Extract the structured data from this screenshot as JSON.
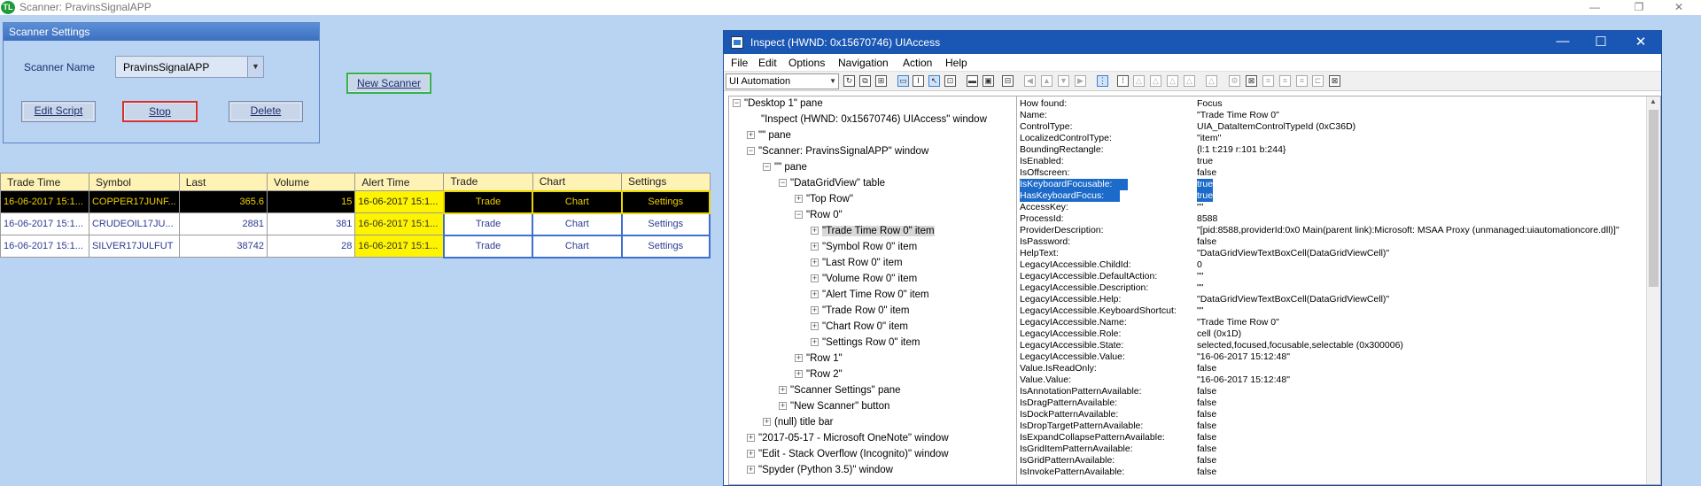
{
  "window": {
    "app_icon": "TL",
    "title": "Scanner: PravinsSignalAPP",
    "min_glyph": "—",
    "max_glyph": "❐",
    "close_glyph": "✕"
  },
  "scanner_settings": {
    "header": "Scanner Settings",
    "name_label": "Scanner Name",
    "name_value": "PravinsSignalAPP",
    "edit_script": "Edit Script",
    "stop": "Stop",
    "delete": "Delete"
  },
  "new_scanner": "New Scanner",
  "grid": {
    "columns": [
      "Trade Time",
      "Symbol",
      "Last",
      "Volume",
      "Alert Time",
      "Trade",
      "Chart",
      "Settings"
    ],
    "rows": [
      {
        "trade_time": "16-06-2017 15:1...",
        "symbol": "COPPER17JUNF...",
        "last": "365.6",
        "volume": "15",
        "alert_time": "16-06-2017 15:1...",
        "trade": "Trade",
        "chart": "Chart",
        "settings": "Settings"
      },
      {
        "trade_time": "16-06-2017 15:1...",
        "symbol": "CRUDEOIL17JU...",
        "last": "2881",
        "volume": "381",
        "alert_time": "16-06-2017 15:1...",
        "trade": "Trade",
        "chart": "Chart",
        "settings": "Settings"
      },
      {
        "trade_time": "16-06-2017 15:1...",
        "symbol": "SILVER17JULFUT",
        "last": "38742",
        "volume": "28",
        "alert_time": "16-06-2017 15:1...",
        "trade": "Trade",
        "chart": "Chart",
        "settings": "Settings"
      }
    ]
  },
  "inspect": {
    "title": "Inspect  (HWND: 0x15670746) UIAccess",
    "menu": [
      "File",
      "Edit",
      "Options",
      "Navigation",
      "Action",
      "Help"
    ],
    "mode": "UI Automation",
    "tree": [
      {
        "label": "\"Desktop 1\" pane",
        "exp": "−"
      },
      {
        "label": "\"Inspect  (HWND: 0x15670746) UIAccess\" window",
        "exp": ""
      },
      {
        "label": "\"\" pane",
        "exp": "+"
      },
      {
        "label": "\"Scanner: PravinsSignalAPP\" window",
        "exp": "−"
      },
      {
        "label": "\"\" pane",
        "exp": "−"
      },
      {
        "label": "\"DataGridView\" table",
        "exp": "−"
      },
      {
        "label": "\"Top Row\"",
        "exp": "+"
      },
      {
        "label": "\"Row 0\"",
        "exp": "−"
      },
      {
        "label": "\"Trade Time Row 0\" item",
        "exp": "+"
      },
      {
        "label": "\"Symbol Row 0\" item",
        "exp": "+"
      },
      {
        "label": "\"Last Row 0\" item",
        "exp": "+"
      },
      {
        "label": "\"Volume Row 0\" item",
        "exp": "+"
      },
      {
        "label": "\"Alert Time Row 0\" item",
        "exp": "+"
      },
      {
        "label": "\"Trade Row 0\" item",
        "exp": "+"
      },
      {
        "label": "\"Chart Row 0\" item",
        "exp": "+"
      },
      {
        "label": "\"Settings Row 0\" item",
        "exp": "+"
      },
      {
        "label": "\"Row 1\"",
        "exp": "+"
      },
      {
        "label": "\"Row 2\"",
        "exp": "+"
      },
      {
        "label": "\"Scanner Settings\" pane",
        "exp": "+"
      },
      {
        "label": "\"New Scanner\" button",
        "exp": "+"
      },
      {
        "label": "(null) title bar",
        "exp": "+"
      },
      {
        "label": "\"2017-05-17 - Microsoft OneNote\" window",
        "exp": "+"
      },
      {
        "label": "\"Edit - Stack Overflow (Incognito)\" window",
        "exp": "+"
      },
      {
        "label": "\"Spyder (Python 3.5)\" window",
        "exp": "+"
      }
    ],
    "properties": [
      {
        "k": "How found:",
        "v": "Focus"
      },
      {
        "k": "Name:",
        "v": "\"Trade Time Row 0\""
      },
      {
        "k": "ControlType:",
        "v": "UIA_DataItemControlTypeId (0xC36D)"
      },
      {
        "k": "LocalizedControlType:",
        "v": "\"item\""
      },
      {
        "k": "BoundingRectangle:",
        "v": "{l:1 t:219 r:101 b:244}"
      },
      {
        "k": "IsEnabled:",
        "v": "true"
      },
      {
        "k": "IsOffscreen:",
        "v": "false"
      },
      {
        "k": "IsKeyboardFocusable:",
        "v": "true"
      },
      {
        "k": "HasKeyboardFocus:",
        "v": "true"
      },
      {
        "k": "AccessKey:",
        "v": "\"\""
      },
      {
        "k": "ProcessId:",
        "v": "8588"
      },
      {
        "k": "ProviderDescription:",
        "v": "\"[pid:8588,providerId:0x0 Main(parent link):Microsoft: MSAA Proxy (unmanaged:uiautomationcore.dll)]\""
      },
      {
        "k": "IsPassword:",
        "v": "false"
      },
      {
        "k": "HelpText:",
        "v": "\"DataGridViewTextBoxCell(DataGridViewCell)\""
      },
      {
        "k": "LegacyIAccessible.ChildId:",
        "v": "0"
      },
      {
        "k": "LegacyIAccessible.DefaultAction:",
        "v": "\"\""
      },
      {
        "k": "LegacyIAccessible.Description:",
        "v": "\"\""
      },
      {
        "k": "LegacyIAccessible.Help:",
        "v": "\"DataGridViewTextBoxCell(DataGridViewCell)\""
      },
      {
        "k": "LegacyIAccessible.KeyboardShortcut:",
        "v": "\"\""
      },
      {
        "k": "LegacyIAccessible.Name:",
        "v": "\"Trade Time Row 0\""
      },
      {
        "k": "LegacyIAccessible.Role:",
        "v": "cell (0x1D)"
      },
      {
        "k": "LegacyIAccessible.State:",
        "v": "selected,focused,focusable,selectable (0x300006)"
      },
      {
        "k": "LegacyIAccessible.Value:",
        "v": "\"16-06-2017 15:12:48\""
      },
      {
        "k": "Value.IsReadOnly:",
        "v": "false"
      },
      {
        "k": "Value.Value:",
        "v": "\"16-06-2017 15:12:48\""
      },
      {
        "k": "IsAnnotationPatternAvailable:",
        "v": "false"
      },
      {
        "k": "IsDragPatternAvailable:",
        "v": "false"
      },
      {
        "k": "IsDockPatternAvailable:",
        "v": "false"
      },
      {
        "k": "IsDropTargetPatternAvailable:",
        "v": "false"
      },
      {
        "k": "IsExpandCollapsePatternAvailable:",
        "v": "false"
      },
      {
        "k": "IsGridItemPatternAvailable:",
        "v": "false"
      },
      {
        "k": "IsGridPatternAvailable:",
        "v": "false"
      },
      {
        "k": "IsInvokePatternAvailable:",
        "v": "false"
      }
    ]
  }
}
